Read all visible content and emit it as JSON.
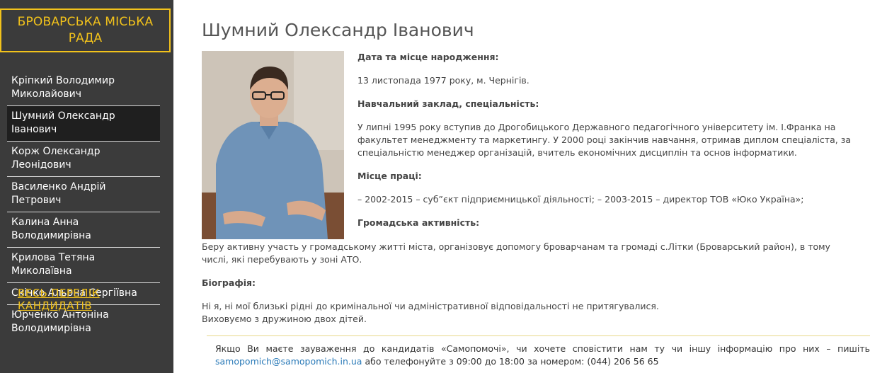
{
  "sidebar": {
    "title": "БРОВАРСЬКА МІСЬКА РАДА",
    "items": [
      {
        "label": "Кріпкий Володимир Миколайович"
      },
      {
        "label": "Шумний Олександр Іванович"
      },
      {
        "label": "Корж Олександр Леонідович"
      },
      {
        "label": "Василенко Андрій Петрович"
      },
      {
        "label": "Калина Анна Володимирівна"
      },
      {
        "label": "Крилова Тетяна Миколаївна"
      },
      {
        "label": "Скічко Альона Сергіївна"
      },
      {
        "label": "Юрченко Антоніна Володимирівна"
      }
    ],
    "active_index": 1,
    "all_link": "ВЕСЬ ПЕРЕЛІК КАНДИДАТІВ"
  },
  "main": {
    "title": "Шумний Олександр Іванович",
    "birth_label": "Дата та місце народження:",
    "birth_value": "13 листопада 1977 року, м. Чернігів.",
    "edu_label": "Навчальний заклад, спеціальність:",
    "edu_value": "У липні 1995 року вступив до Дрогобицького Державного педагогічного університету ім. І.Франка на факультет менеджменту та маркетингу. У 2000 році закінчив навчання, отримав диплом спеціаліста, за спеціальністю менеджер організацій, вчитель економічних дисциплін та основ інформатики.",
    "work_label": "Місце праці:",
    "work_value": "– 2002-2015 – суб”єкт підприємницької діяльності; – 2003-2015 – директор ТОВ «Юко Україна»;",
    "civic_label": "Громадська активність:",
    "civic_value": "Беру активну участь у громадському житті міста, організовує допомогу броварчанам та громаді с.Літки (Броварський район), в тому числі, які перебувають у зоні АТО.",
    "bio_label": "Біографія:",
    "bio_line1": "Ні я, ні мої близькі рідні до кримінальної чи адміністративної відповідальності не притягувалися.",
    "bio_line2": "Виховуємо з дружиною двох дітей."
  },
  "contact": {
    "text_before": "Якщо Ви маєте зауваження до кандидатів «Самопомочі», чи хочете сповістити нам ту чи іншу інформацію про них – пишіть",
    "email": "samopomich@samopomich.in.ua",
    "text_after": " або телефонуйте з 09:00 до 18:00 за номером:  (044) 206 56 65"
  },
  "colors": {
    "sidebar_bg": "#3b3b3b",
    "accent": "#f2c21b",
    "link": "#2a7ab8"
  }
}
